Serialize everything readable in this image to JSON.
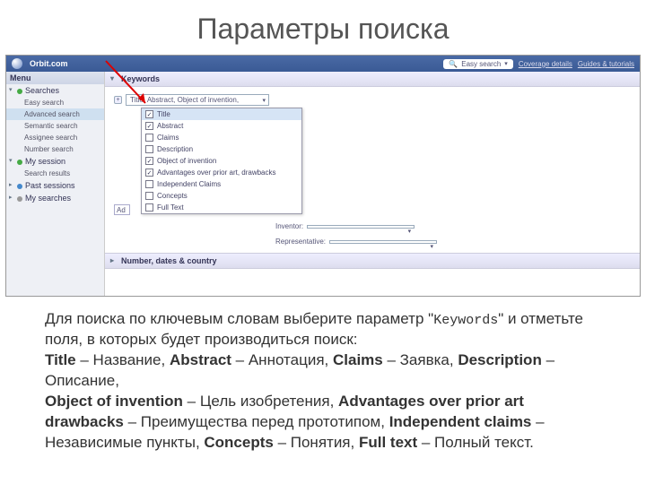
{
  "slide": {
    "title": "Параметры поиска"
  },
  "topbar": {
    "brand": "Orbit.com",
    "easy_search": "Easy search",
    "coverage": "Coverage details",
    "guides": "Guides & tutorials"
  },
  "sidebar": {
    "menu": "Menu",
    "groups": [
      {
        "title": "Searches",
        "dot": "green",
        "open": true,
        "items": [
          "Easy search",
          "Advanced search",
          "Semantic search",
          "Assignee search",
          "Number search"
        ],
        "selected": 1
      },
      {
        "title": "My session",
        "dot": "green",
        "open": true,
        "items": [
          "Search results"
        ]
      },
      {
        "title": "Past sessions",
        "dot": "blue",
        "open": false,
        "items": []
      },
      {
        "title": "My searches",
        "dot": "gray",
        "open": false,
        "items": []
      }
    ]
  },
  "panel": {
    "keywords": "Keywords",
    "combo_value": "Title, Abstract, Object of invention,",
    "plus": "+",
    "ad": "Ad",
    "inventor": "Inventor:",
    "representative": "Representative:",
    "second_panel": "Number, dates & country"
  },
  "dropdown": [
    {
      "label": "Title",
      "checked": true,
      "sel": true
    },
    {
      "label": "Abstract",
      "checked": true
    },
    {
      "label": "Claims",
      "checked": false
    },
    {
      "label": "Description",
      "checked": false
    },
    {
      "label": "Object of invention",
      "checked": true
    },
    {
      "label": "Advantages over prior art, drawbacks",
      "checked": true
    },
    {
      "label": "Independent Claims",
      "checked": false
    },
    {
      "label": "Concepts",
      "checked": false
    },
    {
      "label": "Full Text",
      "checked": false
    }
  ],
  "caption": {
    "l1a": "Для поиска по ключевым словам выберите параметр \"",
    "kw": "Keywords",
    "l1b": "\" и отметьте поля, в которых будет производиться поиск:",
    "parts": [
      {
        "b": "Title",
        "t": " – Название, "
      },
      {
        "b": "Abstract",
        "t": " – Аннотация, "
      },
      {
        "b": "Claims",
        "t": " – Заявка, "
      },
      {
        "b": "Description",
        "t": " – Описание,"
      }
    ],
    "parts2": [
      {
        "b": "Object of invention",
        "t": " – Цель изобретения, "
      },
      {
        "b": "Advantages over prior art drawbacks",
        "t": " – Преимущества перед прототипом, "
      },
      {
        "b": "Independent claims",
        "t": " – Независимые пункты, "
      },
      {
        "b": "Concepts",
        "t": " – Понятия, "
      },
      {
        "b": "Full text",
        "t": " – Полный текст."
      }
    ]
  }
}
